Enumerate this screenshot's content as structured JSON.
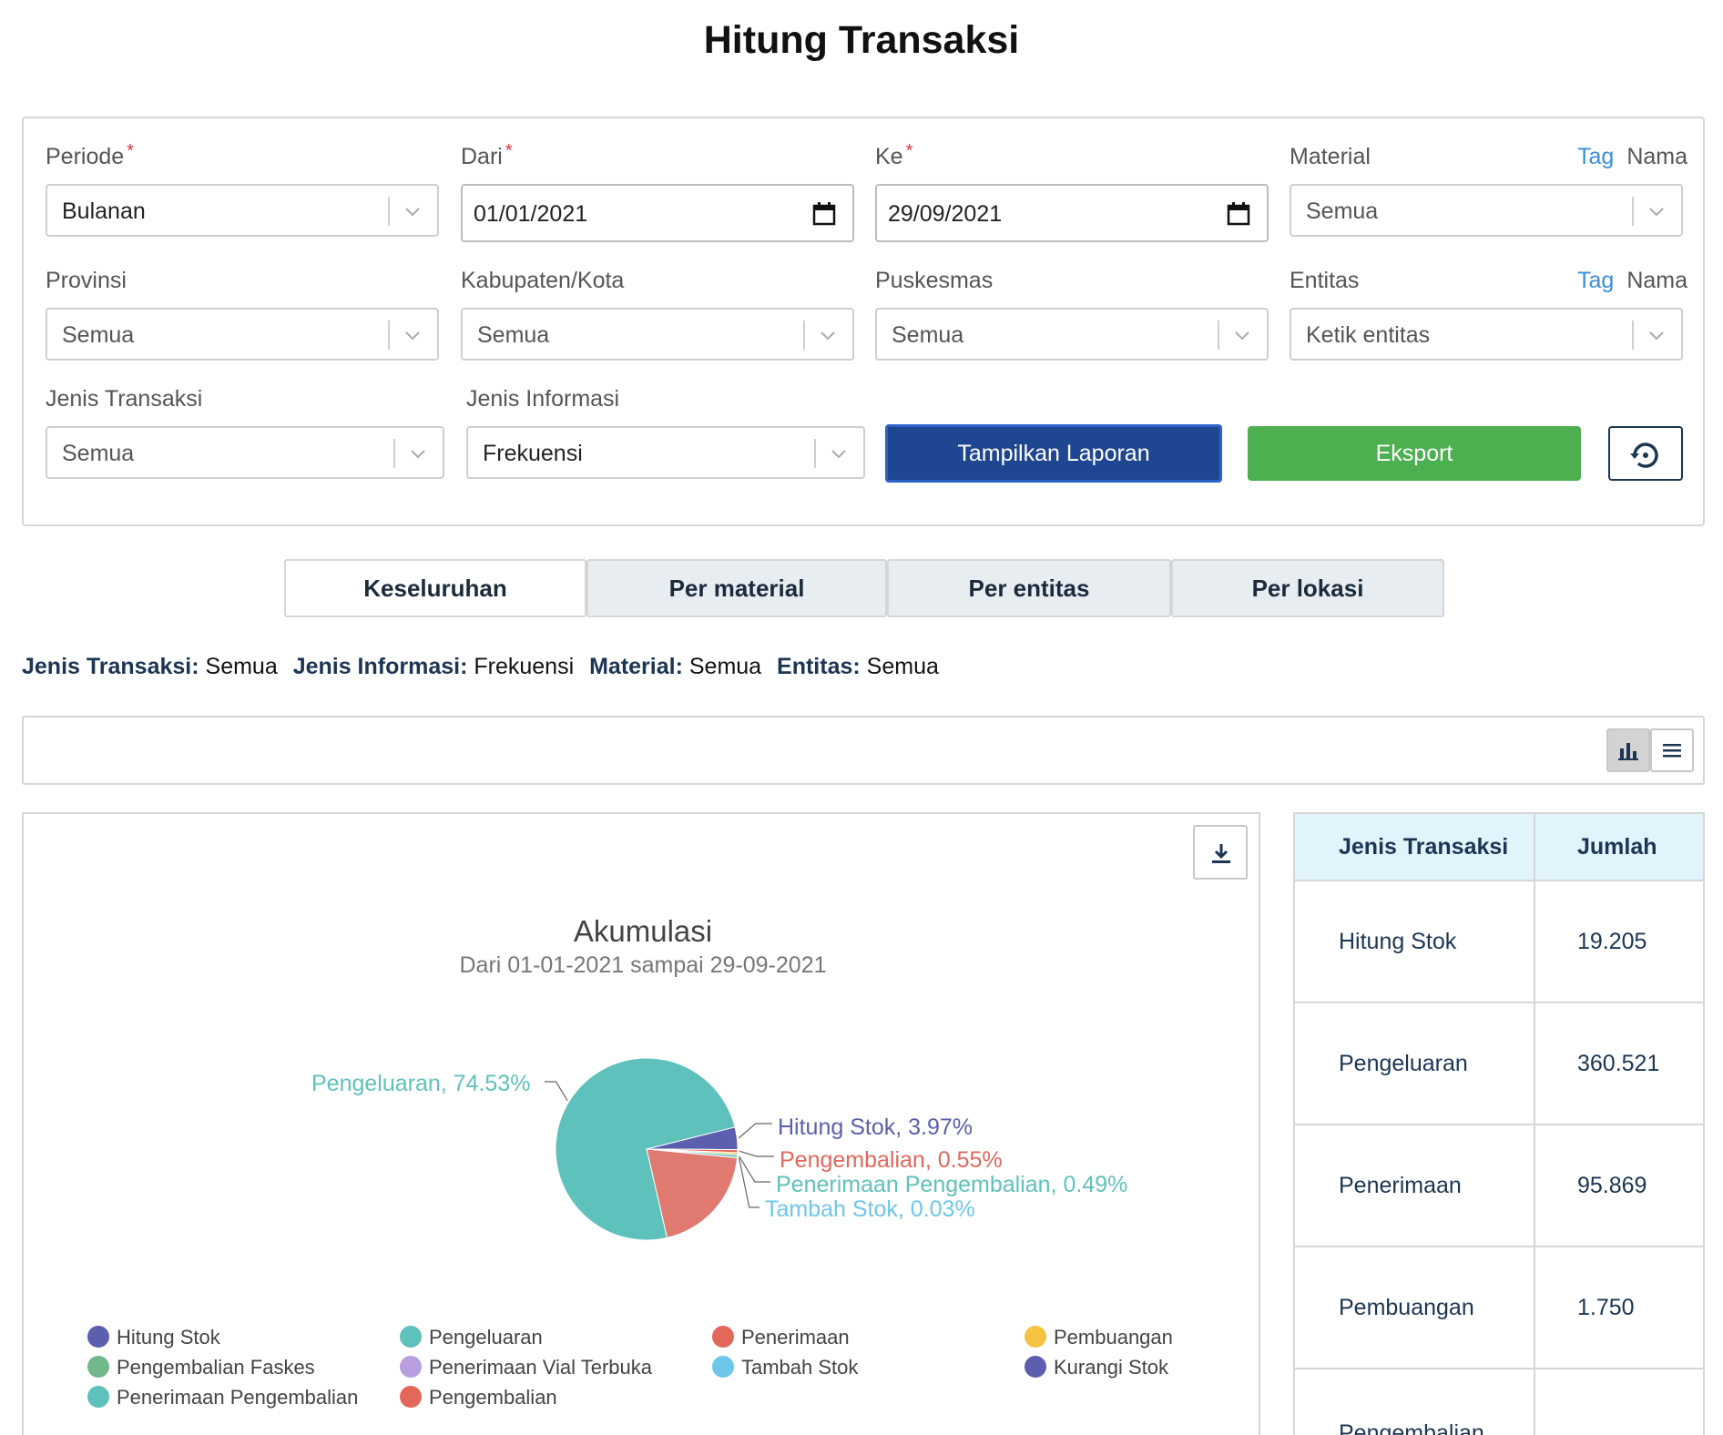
{
  "page": {
    "title": "Hitung Transaksi"
  },
  "filters": {
    "periode": {
      "label": "Periode",
      "value": "Bulanan"
    },
    "dari": {
      "label": "Dari",
      "value": "01/01/2021"
    },
    "ke": {
      "label": "Ke",
      "value": "29/09/2021"
    },
    "material": {
      "label": "Material",
      "tag": "Tag",
      "nama": "Nama",
      "value": "Semua"
    },
    "provinsi": {
      "label": "Provinsi",
      "value": "Semua"
    },
    "kabupaten": {
      "label": "Kabupaten/Kota",
      "value": "Semua"
    },
    "puskesmas": {
      "label": "Puskesmas",
      "value": "Semua"
    },
    "entitas": {
      "label": "Entitas",
      "tag": "Tag",
      "nama": "Nama",
      "placeholder": "Ketik entitas"
    },
    "jenis_transaksi": {
      "label": "Jenis Transaksi",
      "value": "Semua"
    },
    "jenis_informasi": {
      "label": "Jenis Informasi",
      "value": "Frekuensi"
    },
    "required_mark": "*"
  },
  "buttons": {
    "show_report": "Tampilkan Laporan",
    "export": "Eksport"
  },
  "tabs": [
    "Keseluruhan",
    "Per material",
    "Per entitas",
    "Per lokasi"
  ],
  "summary": [
    {
      "key": "Jenis Transaksi:",
      "value": "Semua"
    },
    {
      "key": "Jenis Informasi:",
      "value": "Frekuensi"
    },
    {
      "key": "Material:",
      "value": "Semua"
    },
    {
      "key": "Entitas:",
      "value": "Semua"
    }
  ],
  "icons": {
    "reset": "history-icon",
    "bar_view": "bar-chart-icon",
    "list_view": "list-icon",
    "download": "download-icon",
    "calendar": "calendar-icon",
    "dropdown": "chevron-down-icon"
  },
  "chart_data": {
    "type": "pie",
    "title": "Akumulasi",
    "subtitle": "Dari 01-01-2021 sampai 29-09-2021",
    "slices": [
      {
        "name": "Hitung Stok",
        "value": 3.97,
        "label": "Hitung Stok, 3.97%",
        "color": "#5b5fad"
      },
      {
        "name": "Pengembalian",
        "value": 0.55,
        "label": "Pengembalian, 0.55%",
        "color": "#e3675b"
      },
      {
        "name": "Pembuangan",
        "value": 0.35,
        "color": "#f5c242"
      },
      {
        "name": "Penerimaan Pengembalian",
        "value": 0.49,
        "label": "Penerimaan Pengembalian, 0.49%",
        "color": "#5fc1bb"
      },
      {
        "name": "Tambah Stok",
        "value": 0.03,
        "label": "Tambah Stok, 0.03%",
        "color": "#6ec6ea"
      },
      {
        "name": "Penerimaan",
        "value": 19.82,
        "color": "#e07a70"
      },
      {
        "name": "Pengeluaran",
        "value": 74.53,
        "label": "Pengeluaran, 74.53%",
        "color": "#5fc1bb"
      }
    ],
    "legend": [
      {
        "name": "Hitung Stok",
        "color": "#5b5fad"
      },
      {
        "name": "Pengeluaran",
        "color": "#5fc1bb"
      },
      {
        "name": "Penerimaan",
        "color": "#e3675b"
      },
      {
        "name": "Pembuangan",
        "color": "#f5c242"
      },
      {
        "name": "Pengembalian Faskes",
        "color": "#72b88b"
      },
      {
        "name": "Penerimaan Vial Terbuka",
        "color": "#b99ee0"
      },
      {
        "name": "Tambah Stok",
        "color": "#6ec6ea"
      },
      {
        "name": "Kurangi Stok",
        "color": "#5b5fad"
      },
      {
        "name": "Penerimaan Pengembalian",
        "color": "#5fc1bb"
      },
      {
        "name": "Pengembalian",
        "color": "#e3675b"
      }
    ]
  },
  "table": {
    "headers": [
      "Jenis Transaksi",
      "Jumlah"
    ],
    "rows": [
      [
        "Hitung Stok",
        "19.205"
      ],
      [
        "Pengeluaran",
        "360.521"
      ],
      [
        "Penerimaan",
        "95.869"
      ],
      [
        "Pembuangan",
        "1.750"
      ],
      [
        "Pengembalian",
        ""
      ]
    ]
  }
}
